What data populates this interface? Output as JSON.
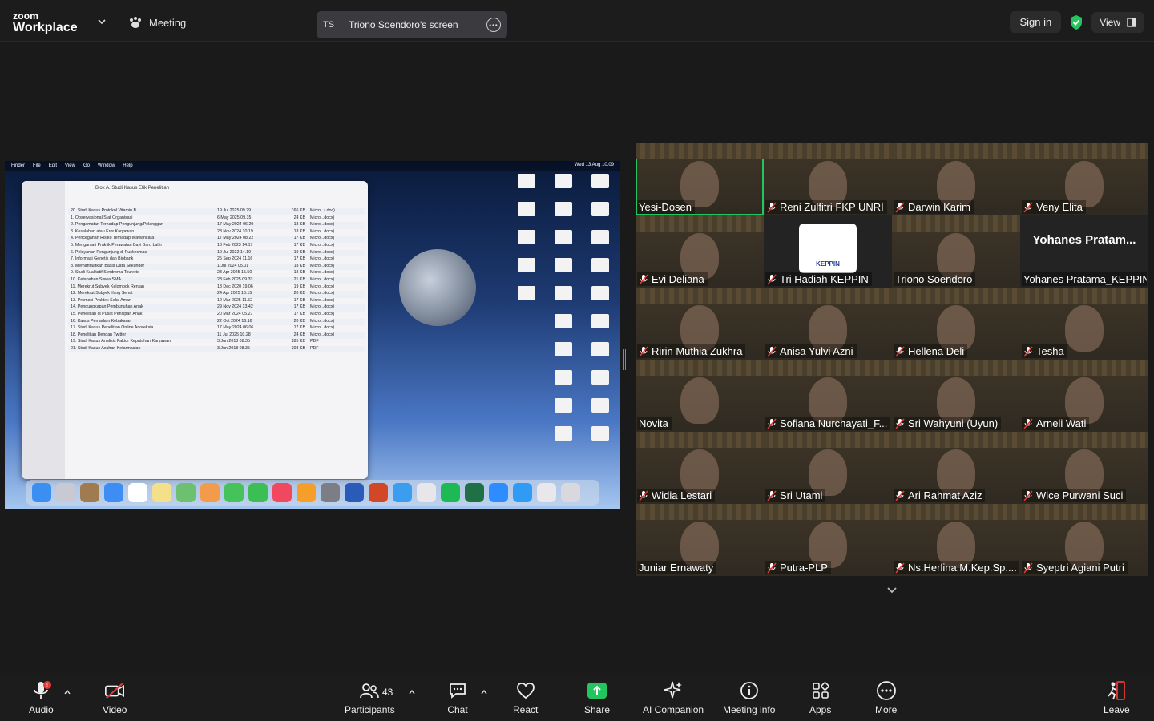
{
  "app": {
    "brand_line1": "zoom",
    "brand_line2": "Workplace",
    "meeting_label": "Meeting"
  },
  "share_pill": {
    "initials": "TS",
    "title": "Triono Soendoro's screen"
  },
  "top_right": {
    "signin": "Sign in",
    "view": "View"
  },
  "shared_screen": {
    "menubar": [
      "Finder",
      "File",
      "Edit",
      "View",
      "Go",
      "Window",
      "Help"
    ],
    "clock": "Wed 13 Aug  10.09",
    "finder_title": "Blok A. Studi Kasus Etik Penelitian",
    "files": [
      {
        "name": "20. Studi Kasus Protokol Vitamin B",
        "date": "19 Jul 2025 09.29",
        "size": "166 KB",
        "kind": "Micro...(.doc)"
      },
      {
        "name": "1. Observasional Staf Organisasi",
        "date": "6 May 2025 09.35",
        "size": "24 KB",
        "kind": "Micro...docx)"
      },
      {
        "name": "2. Pengamatan Terhadap Pengunjung/Pelanggan",
        "date": "17 May 2024 06.20",
        "size": "18 KB",
        "kind": "Micro...docx)"
      },
      {
        "name": "3. Kesalahan atau Eror Karyawan",
        "date": "28 Nov 2024 10.19",
        "size": "18 KB",
        "kind": "Micro...docx)"
      },
      {
        "name": "4. Pencegahan Risiko Terhadap Wawancara",
        "date": "17 May 2024 08.22",
        "size": "17 KB",
        "kind": "Micro...docx)"
      },
      {
        "name": "5. Mengamati Praktik Perawatan Bayi Baru Lahir",
        "date": "13 Feb 2023 14.17",
        "size": "17 KB",
        "kind": "Micro...docx)"
      },
      {
        "name": "6. Pelayanan Pengunjung di Puskesmas",
        "date": "19 Jul 2022 14.10",
        "size": "19 KB",
        "kind": "Micro...docx)"
      },
      {
        "name": "7. Informasi Genetik dan Biobank",
        "date": "25 Sep 2024 11.16",
        "size": "17 KB",
        "kind": "Micro...docx)"
      },
      {
        "name": "8. Memanfaatkan Basis Data Sekunder",
        "date": "1 Jul 2024 05.01",
        "size": "18 KB",
        "kind": "Micro...docx)"
      },
      {
        "name": "9. Studi Kualitatif Syndroma Tourette",
        "date": "23 Apr 2025 15.50",
        "size": "18 KB",
        "kind": "Micro...docx)"
      },
      {
        "name": "10. Ketabahan Siswa SMA",
        "date": "28 Feb 2025 09.33",
        "size": "21 KB",
        "kind": "Micro...docx)"
      },
      {
        "name": "11. Merekrut Subyek Kelompok Rentan",
        "date": "18 Dec 2020 19.06",
        "size": "19 KB",
        "kind": "Micro...docx)"
      },
      {
        "name": "12. Merekrut Subyek Yang Sehat",
        "date": "24 Apr 2025 10.15",
        "size": "20 KB",
        "kind": "Micro...docx)"
      },
      {
        "name": "13. Promosi Praktek Seks Aman",
        "date": "12 Mar 2025 11.52",
        "size": "17 KB",
        "kind": "Micro...docx)"
      },
      {
        "name": "14. Pengungkapan Pembunuhan Anak",
        "date": "29 Nov 2024 13.42",
        "size": "17 KB",
        "kind": "Micro...docx)"
      },
      {
        "name": "15. Penelitian di Pusat Penitipan Anak",
        "date": "20 Mar 2024 05.27",
        "size": "17 KB",
        "kind": "Micro...docx)"
      },
      {
        "name": "16. Kasus Pemadam Kebakaran",
        "date": "22 Oct 2024 16.16",
        "size": "20 KB",
        "kind": "Micro...docx)"
      },
      {
        "name": "17. Studi Kasus Penelitian Online Anoreksia",
        "date": "17 May 2024 06.06",
        "size": "17 KB",
        "kind": "Micro...docx)"
      },
      {
        "name": "18. Penelitian Dengan Twitter",
        "date": "11 Jul 2025 10.28",
        "size": "24 KB",
        "kind": "Micro...docx)"
      },
      {
        "name": "19. Studi Kasus Analisis Faktor Kepatuhan Karyawan",
        "date": "3 Jun 2018 08.35",
        "size": "285 KB",
        "kind": "PDF"
      },
      {
        "name": "21. Studi Kasus Asuhan Kefarmasian",
        "date": "3 Jun 2018 08.35",
        "size": "308 KB",
        "kind": "PDF"
      }
    ]
  },
  "participants": [
    {
      "name": "Yesi-Dosen",
      "muted": false,
      "active": true,
      "kind": "video"
    },
    {
      "name": "Reni Zulfitri FKP UNRI",
      "muted": true,
      "kind": "video"
    },
    {
      "name": "Darwin Karim",
      "muted": true,
      "kind": "video"
    },
    {
      "name": "Veny Elita",
      "muted": true,
      "kind": "video"
    },
    {
      "name": "Evi Deliana",
      "muted": true,
      "kind": "video"
    },
    {
      "name": "Tri Hadiah KEPPIN",
      "muted": true,
      "kind": "logo",
      "logo_text": "KEPPIN"
    },
    {
      "name": "Triono Soendoro",
      "muted": false,
      "kind": "video"
    },
    {
      "name": "Yohanes Pratama_KEPPIN",
      "muted": false,
      "kind": "name",
      "big_name": "Yohanes  Pratam..."
    },
    {
      "name": "Ririn Muthia Zukhra",
      "muted": true,
      "kind": "video"
    },
    {
      "name": "Anisa Yulvi Azni",
      "muted": true,
      "kind": "video"
    },
    {
      "name": "Hellena Deli",
      "muted": true,
      "kind": "video"
    },
    {
      "name": "Tesha",
      "muted": true,
      "kind": "video"
    },
    {
      "name": "Novita",
      "muted": false,
      "kind": "video"
    },
    {
      "name": "Sofiana Nurchayati_F...",
      "muted": true,
      "kind": "video"
    },
    {
      "name": "Sri Wahyuni (Uyun)",
      "muted": true,
      "kind": "video"
    },
    {
      "name": "Arneli Wati",
      "muted": true,
      "kind": "video"
    },
    {
      "name": "Widia Lestari",
      "muted": true,
      "kind": "video"
    },
    {
      "name": "Sri Utami",
      "muted": true,
      "kind": "video"
    },
    {
      "name": "Ari Rahmat Aziz",
      "muted": true,
      "kind": "video"
    },
    {
      "name": "Wice Purwani Suci",
      "muted": true,
      "kind": "video"
    },
    {
      "name": "Juniar Ernawaty",
      "muted": false,
      "kind": "video"
    },
    {
      "name": "Putra-PLP",
      "muted": true,
      "kind": "video"
    },
    {
      "name": "Ns.Herlina,M.Kep.Sp....",
      "muted": true,
      "kind": "video"
    },
    {
      "name": "Syeptri Agiani Putri",
      "muted": true,
      "kind": "video"
    }
  ],
  "toolbar": {
    "audio": "Audio",
    "audio_badge": "!",
    "video": "Video",
    "participants": "Participants",
    "participants_count": "43",
    "chat": "Chat",
    "react": "React",
    "share": "Share",
    "ai": "AI Companion",
    "info": "Meeting info",
    "apps": "Apps",
    "more": "More",
    "leave": "Leave"
  },
  "colors": {
    "active_speaker": "#22c55e",
    "share_green": "#22c55e",
    "muted_red": "#e53935",
    "shield_green": "#22c55e"
  }
}
